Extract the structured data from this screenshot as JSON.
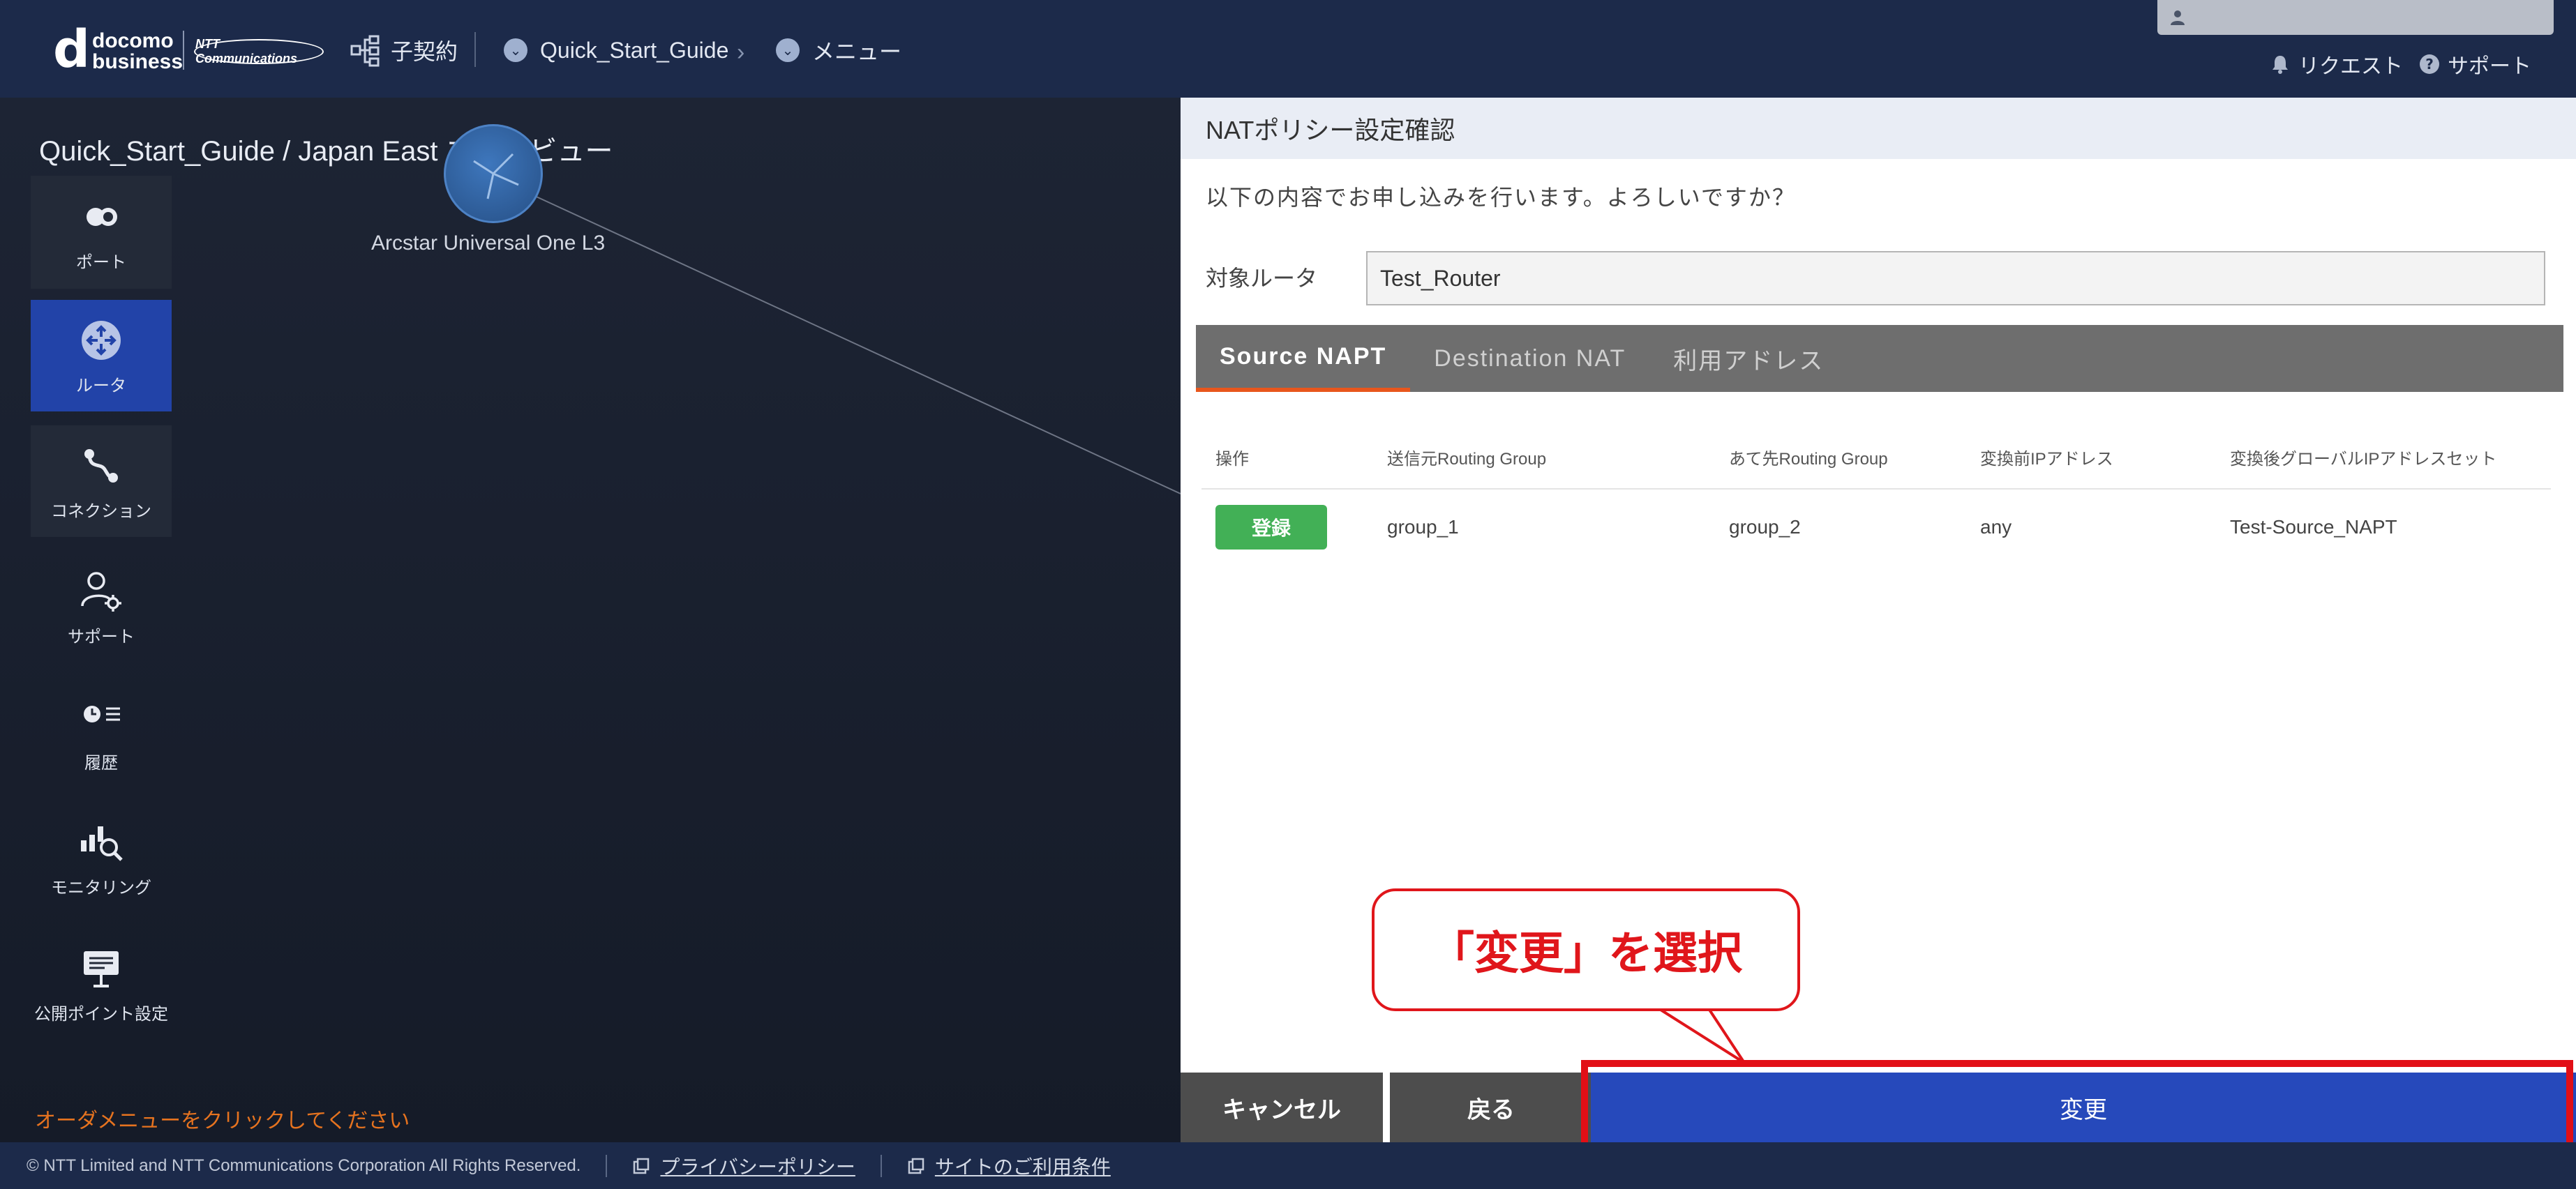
{
  "header": {
    "logo_mark": "d",
    "logo_line1": "docomo",
    "logo_line2": "business",
    "ntt_logo": "NTT Communications",
    "contract_label": "子契約",
    "breadcrumb": [
      "Quick_Start_Guide",
      "メニュー"
    ],
    "request_label": "リクエスト",
    "support_label": "サポート"
  },
  "canvas": {
    "area_title": "Quick_Start_Guide / Japan East エリアビュー",
    "node_label": "Arcstar Universal One L3",
    "order_hint": "オーダメニューをクリックしてください"
  },
  "sidebar": {
    "items": [
      {
        "label": "ポート",
        "icon": "port-icon"
      },
      {
        "label": "ルータ",
        "icon": "router-icon",
        "active": true
      },
      {
        "label": "コネクション",
        "icon": "connection-icon"
      },
      {
        "label": "サポート",
        "icon": "support-icon"
      },
      {
        "label": "履歴",
        "icon": "history-icon"
      },
      {
        "label": "モニタリング",
        "icon": "monitoring-icon"
      },
      {
        "label": "公開ポイント設定",
        "icon": "public-point-icon"
      }
    ]
  },
  "panel": {
    "title": "NATポリシー設定確認",
    "confirm_message": "以下の内容でお申し込みを行います。よろしいですか？",
    "router_label": "対象ルータ",
    "router_value": "Test_Router",
    "tabs": [
      "Source NAPT",
      "Destination NAT",
      "利用アドレス"
    ],
    "active_tab": "Source NAPT",
    "table": {
      "headers": [
        "操作",
        "送信元Routing Group",
        "あて先Routing Group",
        "変換前IPアドレス",
        "変換後グローバルIPアドレスセット"
      ],
      "rows": [
        {
          "action": "登録",
          "src": "group_1",
          "dst": "group_2",
          "before_ip": "any",
          "after_set": "Test-Source_NAPT"
        }
      ]
    },
    "buttons": {
      "cancel": "キャンセル",
      "back": "戻る",
      "change": "変更"
    }
  },
  "callout": {
    "text": "「変更」を選択"
  },
  "footer": {
    "copyright": "© NTT Limited and NTT Communications Corporation All Rights Reserved.",
    "privacy": "プライバシーポリシー",
    "terms": "サイトのご利用条件"
  },
  "colors": {
    "header_bg": "#1c2a4a",
    "active_side": "#2243a8",
    "change_button": "#2649bb",
    "register_button": "#42b056",
    "highlight": "#e20f16",
    "tab_accent": "#e8561c",
    "hint_text": "#e6731f"
  }
}
